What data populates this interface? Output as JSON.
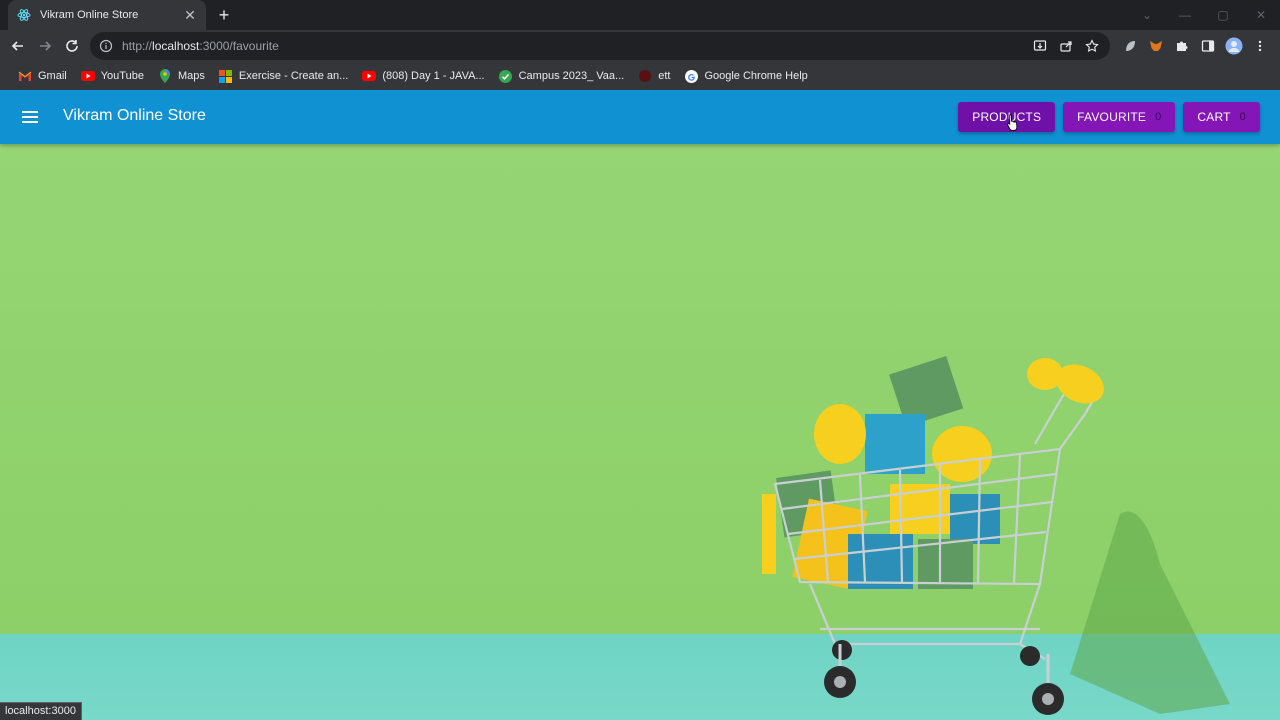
{
  "browser": {
    "tab_title": "Vikram Online Store",
    "url_scheme": "http://",
    "url_host": "localhost",
    "url_path": ":3000/favourite",
    "bookmarks": [
      {
        "label": "Gmail",
        "icon": "gmail-icon"
      },
      {
        "label": "YouTube",
        "icon": "youtube-icon"
      },
      {
        "label": "Maps",
        "icon": "maps-icon"
      },
      {
        "label": "Exercise - Create an...",
        "icon": "microsoft-icon"
      },
      {
        "label": "(808) Day 1 - JAVA...",
        "icon": "youtube-icon"
      },
      {
        "label": "Campus 2023_ Vaa...",
        "icon": "check-icon"
      },
      {
        "label": "ett",
        "icon": "site-icon"
      },
      {
        "label": "Google Chrome Help",
        "icon": "google-icon"
      }
    ],
    "status_text": "localhost:3000"
  },
  "app": {
    "title": "Vikram Online Store",
    "nav": {
      "products_label": "PRODUCTS",
      "favourite_label": "FAVOURITE",
      "favourite_count": "0",
      "cart_label": "CART",
      "cart_count": "0"
    }
  },
  "colors": {
    "appbar": "#0f91d2",
    "nav_button": "#8415b7",
    "hero_bg": "#8fd16b",
    "floor": "#72d6c6"
  }
}
